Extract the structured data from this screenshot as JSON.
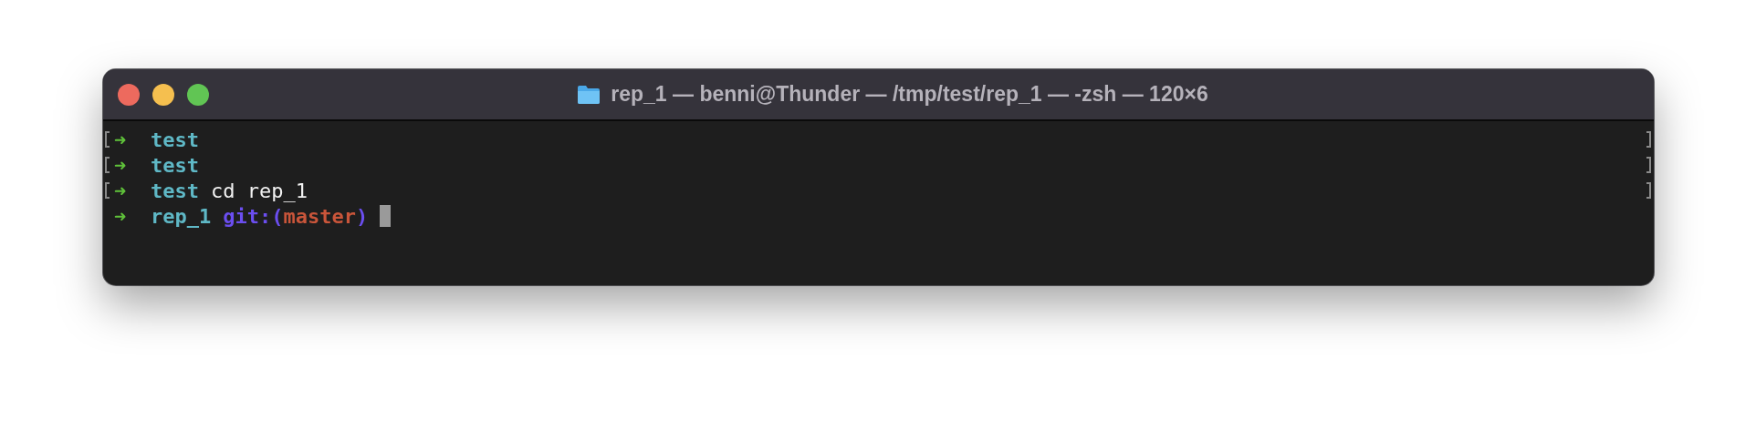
{
  "window": {
    "title": "rep_1 — benni@Thunder — /tmp/test/rep_1 — -zsh — 120×6"
  },
  "lines": [
    {
      "marked": true,
      "cursor": false,
      "arrow": "➜",
      "dir": "test"
    },
    {
      "marked": true,
      "cursor": false,
      "arrow": "➜",
      "dir": "test"
    },
    {
      "marked": true,
      "cursor": false,
      "arrow": "➜",
      "dir": "test",
      "command": "cd rep_1"
    },
    {
      "marked": false,
      "cursor": true,
      "arrow": "➜",
      "dir": "rep_1",
      "git": {
        "prefix": "git:(",
        "branch": "master",
        "suffix": ")"
      }
    }
  ]
}
